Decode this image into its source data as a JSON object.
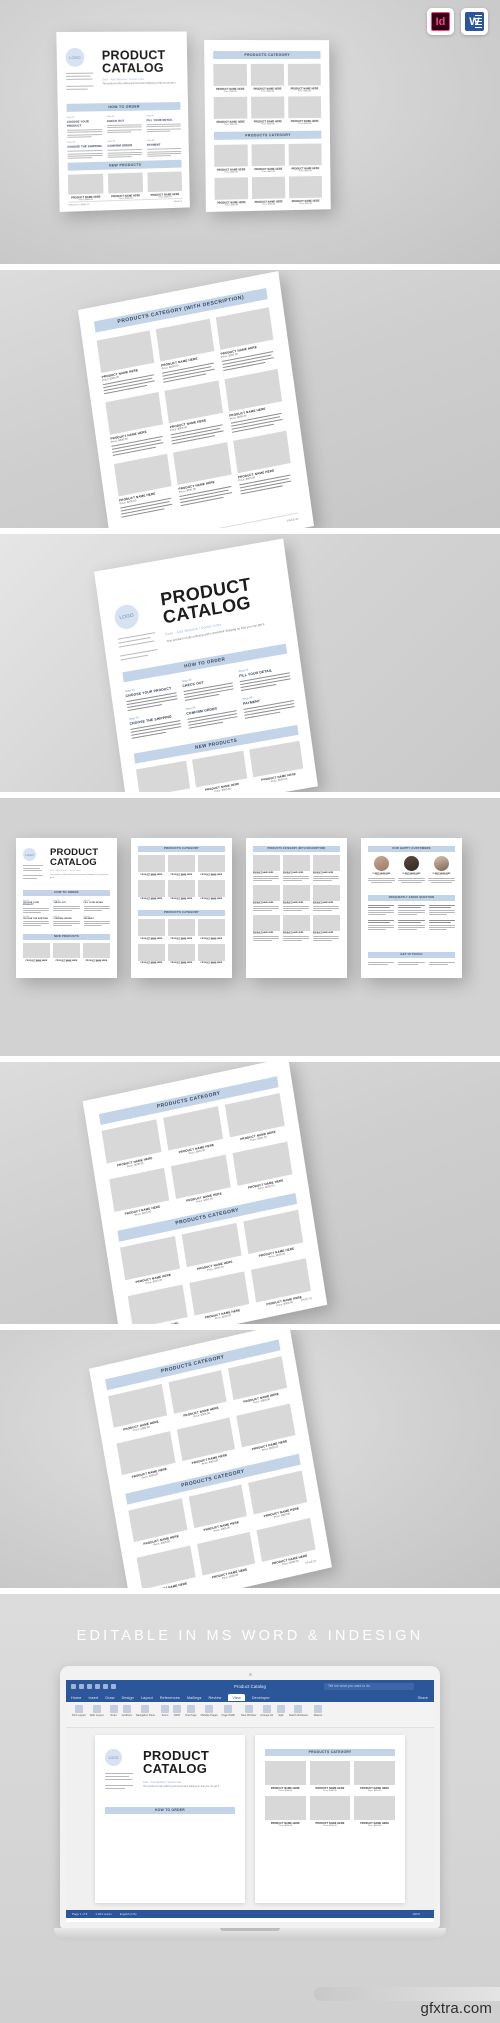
{
  "meta": {
    "watermark": "gfxtra.com"
  },
  "app_icons": [
    {
      "name": "indesign-icon",
      "label": "Id"
    },
    {
      "name": "word-icon",
      "label": "W"
    }
  ],
  "catalog": {
    "title_line1": "PRODUCT",
    "title_line2": "CATALOG",
    "logo_text": "LOGO",
    "subtitle": "Date  -  Add Website / Social Links",
    "intro": "This product is fully outlining and convenient shipping so that you can get it.",
    "footer": "PRODUCT CATALOG",
    "page_no": "PAGE 01"
  },
  "sections": {
    "how_to_order": "HOW TO ORDER",
    "new_products": "NEW PRODUCTS",
    "products_category": "PRODUCTS CATEGORY",
    "products_category_desc": "PRODUCTS CATEGORY (WITH DESCRIPTION)",
    "happy_customers": "OUR HAPPY CUSTOMERS",
    "faq": "FREQUENTLY ASKED QUESTION",
    "get_in_touch": "GET IN TOUCH"
  },
  "steps": [
    {
      "num": "Step 01",
      "title": "CHOOSE YOUR PRODUCT"
    },
    {
      "num": "Step 02",
      "title": "CHECK OUT"
    },
    {
      "num": "Step 03",
      "title": "FILL YOUR DETAIL"
    },
    {
      "num": "Step 04",
      "title": "CHOOSE THE SHIPPING"
    },
    {
      "num": "Step 05",
      "title": "CONFIRM ORDER"
    },
    {
      "num": "Step 06",
      "title": "PAYMENT"
    }
  ],
  "product": {
    "name": "PRODUCT NAME HERE",
    "price": "Price: $000.00"
  },
  "customer": {
    "name": "CLIENT NAME HERE",
    "role": "Company / Position"
  },
  "contact_lines": [
    "Add Your Address Here",
    "Your City, State, Country",
    "www.yourwebsite.com",
    "Phone: +00 000 0000",
    "Email: hello@mail.com"
  ],
  "banner": {
    "text": "EDITABLE IN MS WORD & INDESIGN"
  },
  "word_ui": {
    "doc_title": "Product Catalog",
    "search_placeholder": "Tell me what you want to do",
    "tabs": [
      "Home",
      "Insert",
      "Draw",
      "Design",
      "Layout",
      "References",
      "Mailings",
      "Review",
      "View",
      "Developer"
    ],
    "active_tab": "View",
    "share_label": "Share",
    "ribbon_buttons": [
      "Print Layout",
      "Web Layout",
      "Ruler",
      "Gridlines",
      "Navigation Pane",
      "Zoom",
      "100%",
      "One Page",
      "Multiple Pages",
      "Page Width",
      "New Window",
      "Arrange All",
      "Split",
      "Switch Windows",
      "Macros"
    ],
    "status_items": [
      "Page 1 of 8",
      "1,024 words",
      "English (US)",
      "100%"
    ]
  },
  "colors": {
    "accent_band": "#c3d3e8",
    "word_blue": "#2b579a",
    "indesign_pink": "#ff3f8e",
    "background": "#d2d2d2"
  }
}
